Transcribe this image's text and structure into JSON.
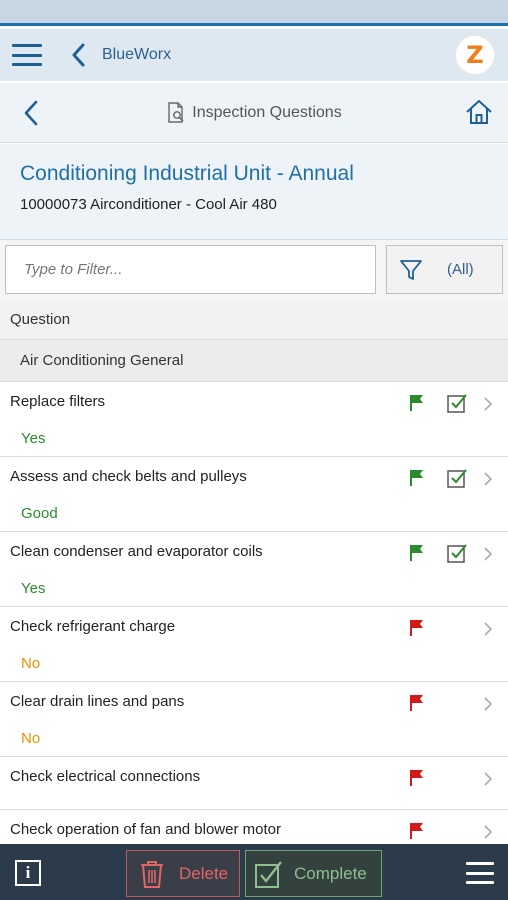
{
  "app": {
    "title": "BlueWorx",
    "logo_letter": "Z",
    "icons": [
      "hamburger-icon",
      "back-icon",
      "logo"
    ]
  },
  "page": {
    "title": "Inspection Questions",
    "icons": [
      "back-icon",
      "document-search-icon",
      "home-icon"
    ]
  },
  "object": {
    "title": "Conditioning Industrial Unit - Annual",
    "subtitle": "10000073 Airconditioner - Cool Air 480"
  },
  "filter": {
    "placeholder": "Type to Filter...",
    "button_label": "(All)"
  },
  "table": {
    "column_header": "Question",
    "group_header": "Air Conditioning General"
  },
  "questions": [
    {
      "question": "Replace filters",
      "answer": "Yes",
      "answer_status": "good",
      "flag": "green",
      "checked": true
    },
    {
      "question": "Assess and check belts and pulleys",
      "answer": "Good",
      "answer_status": "good",
      "flag": "green",
      "checked": true
    },
    {
      "question": "Clean condenser and evaporator coils",
      "answer": "Yes",
      "answer_status": "good",
      "flag": "green",
      "checked": true
    },
    {
      "question": "Check refrigerant charge",
      "answer": "No",
      "answer_status": "warning",
      "flag": "red",
      "checked": false
    },
    {
      "question": "Clear drain lines and pans",
      "answer": "No",
      "answer_status": "warning",
      "flag": "red",
      "checked": false
    },
    {
      "question": "Check electrical connections",
      "answer": "",
      "answer_status": "none",
      "flag": "red",
      "checked": false
    },
    {
      "question": "Check operation of fan and blower motor",
      "answer": "",
      "answer_status": "none",
      "flag": "red",
      "checked": false
    }
  ],
  "footer": {
    "delete_label": "Delete",
    "complete_label": "Complete",
    "info_label": "i"
  },
  "colors": {
    "accent": "#1f6fa8",
    "flag_green": "#2b8a2b",
    "flag_red": "#d11a1a",
    "answer_good": "#2b8a2b",
    "answer_warning": "#e69100",
    "footer_bg": "#2b3b4b"
  }
}
